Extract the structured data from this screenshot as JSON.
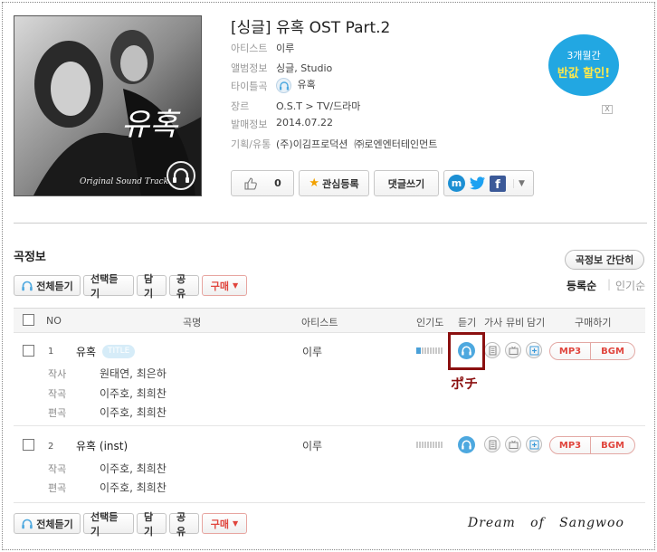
{
  "album": {
    "title": "[싱글] 유혹 OST Part.2",
    "cover_text": "Original Sound Track",
    "cover_title_glyph": "유혹",
    "meta": [
      {
        "key": "아티스트",
        "value": "이루"
      },
      {
        "key": "앨범정보",
        "value": "싱글, Studio"
      },
      {
        "key": "타이틀곡",
        "value": "유혹"
      },
      {
        "key": "장르",
        "value": "O.S.T > TV/드라마"
      },
      {
        "key": "발매정보",
        "value": "2014.07.22"
      },
      {
        "key": "기획/유통",
        "value": "(주)이김프로덕션  ㈜로엔엔터테인먼트"
      }
    ]
  },
  "actions": {
    "like_count": "0",
    "favorite_label": "관심등록",
    "comment_label": "댓글쓰기"
  },
  "ad": {
    "line1": "3개월간",
    "line2": "반값 할인!",
    "close": "X"
  },
  "section": {
    "title": "곡정보",
    "toggle_label": "곡정보 간단히",
    "sort_active": "등록순",
    "sort_sep": "|",
    "sort_other": "인기순"
  },
  "toolbar": {
    "play_all": "전체듣기",
    "play_selected": "선택듣기",
    "add": "담기",
    "share": "공유",
    "buy": "구매"
  },
  "table": {
    "headers": {
      "no": "NO",
      "song": "곡명",
      "artist": "아티스트",
      "popularity": "인기도",
      "listen": "듣기",
      "lyrics": "가사",
      "mv": "뮤비",
      "add": "담기",
      "buy": "구매하기"
    },
    "rows": [
      {
        "no": "1",
        "title": "유혹",
        "badge": "TITLE",
        "artist": "이루",
        "popularity": 0.15,
        "mp3": "MP3",
        "bgm": "BGM",
        "credits": [
          {
            "role": "작사",
            "names": "원태연, 최은하"
          },
          {
            "role": "작곡",
            "names": "이주호, 최희찬"
          },
          {
            "role": "편곡",
            "names": "이주호, 최희찬"
          }
        ]
      },
      {
        "no": "2",
        "title": "유혹 (inst)",
        "artist": "이루",
        "popularity": 0.0,
        "mp3": "MP3",
        "bgm": "BGM",
        "credits": [
          {
            "role": "작곡",
            "names": "이주호, 최희찬"
          },
          {
            "role": "편곡",
            "names": "이주호, 최희찬"
          }
        ]
      }
    ]
  },
  "annotation": "ポチ",
  "signature": "Dream   of   Sangwoo",
  "colors": {
    "accent_blue": "#4da8df",
    "buy_red": "#e0453d",
    "highlight": "#8b1010",
    "ad_blue": "#22a7e2"
  }
}
